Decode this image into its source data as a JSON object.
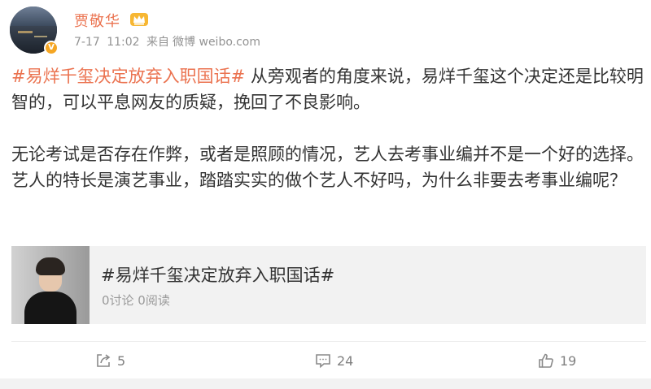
{
  "header": {
    "username": "贾敬华",
    "date": "7-17",
    "time": "11:02",
    "source_prefix": "来自",
    "source": "微博 weibo.com",
    "verified_badge_icon": "verified-v-icon",
    "vip_icon": "crown-icon"
  },
  "post": {
    "topic": "#易烊千玺决定放弃入职国话#",
    "para1_text": " 从旁观者的角度来说，易烊千玺这个决定还是比较明智的，可以平息网友的质疑，挽回了不良影响。",
    "para2_text": "无论考试是否存在作弊，或者是照顾的情况，艺人去考事业编并不是一个好的选择。艺人的特长是演艺事业，踏踏实实的做个艺人不好吗，为什么非要去考事业编呢？"
  },
  "card": {
    "title": "#易烊千玺决定放弃入职国话#",
    "stats": "0讨论 0阅读"
  },
  "actions": {
    "share_count": "5",
    "comment_count": "24",
    "like_count": "19",
    "share_icon": "share-icon",
    "comment_icon": "comment-icon",
    "like_icon": "thumbs-up-icon"
  },
  "colors": {
    "accent": "#eb7350",
    "meta_text": "#939393",
    "card_bg": "#f2f2f2"
  }
}
